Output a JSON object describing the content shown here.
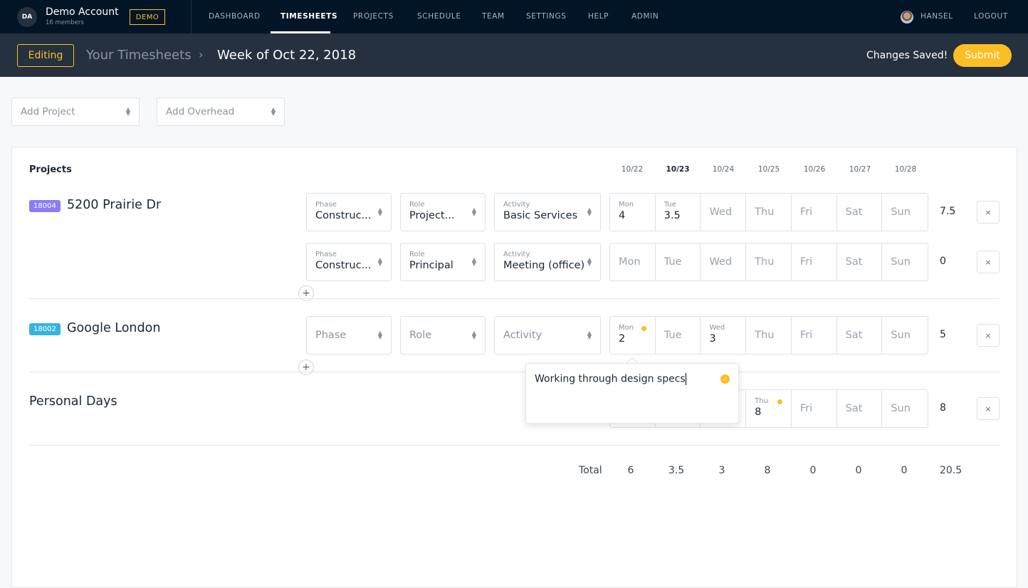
{
  "account": {
    "initials": "DA",
    "name": "Demo Account",
    "members": "16 members",
    "badge": "DEMO"
  },
  "nav": [
    "DASHBOARD",
    "TIMESHEETS",
    "PROJECTS",
    "SCHEDULE",
    "TEAM",
    "SETTINGS",
    "HELP",
    "ADMIN"
  ],
  "active_nav": "TIMESHEETS",
  "user": {
    "name": "HANSEL",
    "logout": "LOGOUT"
  },
  "subheader": {
    "mode": "Editing",
    "breadcrumb": "Your Timesheets",
    "separator": "›",
    "title": "Week of Oct 22, 2018",
    "status": "Changes Saved!",
    "submit": "Submit"
  },
  "toolbar": {
    "add_project": "Add Project",
    "add_overhead": "Add Overhead"
  },
  "grid": {
    "heading": "Projects",
    "dates": [
      "10/22",
      "10/23",
      "10/24",
      "10/25",
      "10/26",
      "10/27",
      "10/28"
    ],
    "bold_date_index": 1,
    "day_names": [
      "Mon",
      "Tue",
      "Wed",
      "Thu",
      "Fri",
      "Sat",
      "Sun"
    ],
    "labels": {
      "phase": "Phase",
      "role": "Role",
      "activity": "Activity"
    },
    "remove": "×",
    "add": "+",
    "projects": [
      {
        "code": "18004",
        "color": "#8b7cf6",
        "name": "5200 Prairie Dr",
        "rows": [
          {
            "phase": "Construc...",
            "role": "Project...",
            "activity": "Basic Services",
            "hours": [
              "4",
              "3.5",
              "",
              "",
              "",
              "",
              ""
            ],
            "notes": [],
            "total": "7.5"
          },
          {
            "phase": "Construc...",
            "role": "Principal",
            "activity": "Meeting (office)",
            "hours": [
              "",
              "",
              "",
              "",
              "",
              "",
              ""
            ],
            "notes": [],
            "total": "0"
          }
        ]
      },
      {
        "code": "18002",
        "color": "#38b2e0",
        "name": "Google London",
        "rows": [
          {
            "phase": "",
            "role": "",
            "activity": "",
            "hours": [
              "2",
              "",
              "3",
              "",
              "",
              "",
              ""
            ],
            "notes": [
              0
            ],
            "total": "5"
          }
        ]
      },
      {
        "code": "",
        "color": "",
        "name": "Personal Days",
        "rows": [
          {
            "phase": null,
            "hours": [
              "",
              "",
              "",
              "8",
              "",
              "",
              ""
            ],
            "notes": [
              3
            ],
            "total": "8"
          }
        ]
      }
    ],
    "totals_label": "Total",
    "totals": [
      "6",
      "3.5",
      "3",
      "8",
      "0",
      "0",
      "0"
    ],
    "grand_total": "20.5"
  },
  "note_popover": {
    "text": "Working through design specs"
  }
}
